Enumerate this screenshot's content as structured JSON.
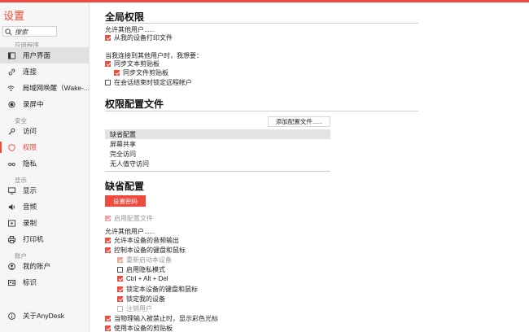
{
  "sidebar": {
    "title": "设置",
    "search_placeholder": "搜索",
    "sections": {
      "app": "应用程序",
      "security": "安全",
      "display": "显示",
      "account": "账户"
    },
    "items": {
      "ui": "用户界面",
      "connection": "连接",
      "wol": "局域网唤醒（Wake-...",
      "recording": "录屏中",
      "access": "访问",
      "permissions": "权限",
      "privacy": "隐私",
      "display": "显示",
      "audio": "音频",
      "record": "录制",
      "printer": "打印机",
      "my_account": "我的账户",
      "identity": "标识",
      "about": "关于AnyDesk"
    }
  },
  "global": {
    "title": "全局权限",
    "allow_others": "允许其他用户......",
    "print_files": "从我的设备打印文件",
    "when_connecting": "当我连接到其他用户时，我想要：",
    "sync_text_clipboard": "同步文本剪贴板",
    "sync_file_clipboard": "同步文件剪贴板",
    "lock_remote_on_end": "在会话结束时锁定远程帐户"
  },
  "profiles": {
    "title": "权限配置文件",
    "add_button": "添加配置文件......",
    "list": [
      "缺省配置",
      "屏幕共享",
      "完全访问",
      "无人值守访问"
    ]
  },
  "default_profile": {
    "title": "缺省配置",
    "set_password": "设置密码",
    "enable_profile": "启用配置文件",
    "allow_others": "允许其他用户......",
    "audio_out": "允许本设备的音频输出",
    "control_kbd_mouse": "控制本设备的键盘和鼠标",
    "restart_device": "重新启动本设备",
    "privacy_mode": "启用隐私模式",
    "ctrl_alt_del": "Ctrl + Alt + Del",
    "lock_kbd_mouse": "锁定本设备的键盘和鼠标",
    "lock_device": "锁定我的设备",
    "sign_out": "注销用户",
    "show_color_cursor": "当物理输入被禁止时，显示彩色光标",
    "use_clipboard": "使用本设备的剪贴板"
  }
}
